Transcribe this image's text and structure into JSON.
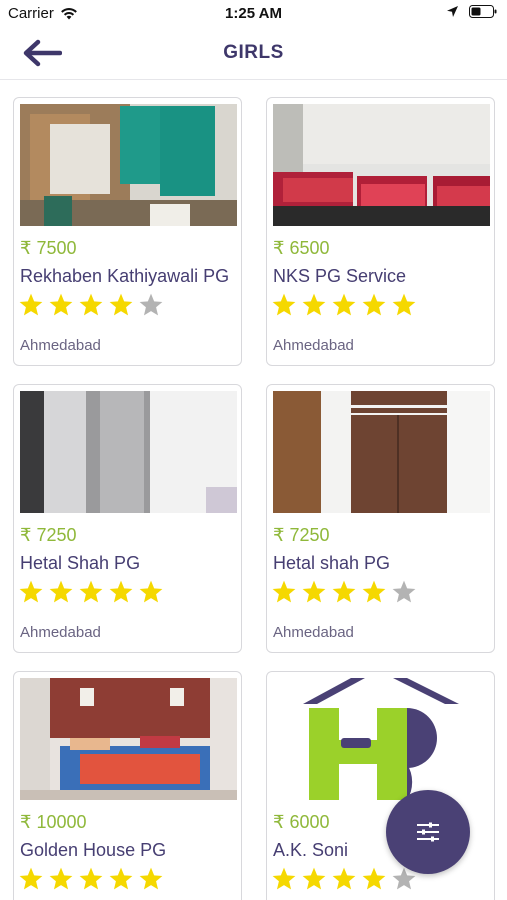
{
  "status_bar": {
    "carrier": "Carrier",
    "time": "1:25 AM"
  },
  "header": {
    "title": "GIRLS"
  },
  "colors": {
    "accent": "#4a4175",
    "price": "#8fb83a",
    "star_on": "#f5d800",
    "star_off": "#b3b3b3"
  },
  "listings": [
    {
      "price": "₹ 7500",
      "name": "Rekhaben Kathiyawali PG",
      "rating": 4,
      "city": "Ahmedabad"
    },
    {
      "price": "₹ 6500",
      "name": "NKS PG Service",
      "rating": 5,
      "city": "Ahmedabad"
    },
    {
      "price": "₹ 7250",
      "name": "Hetal Shah PG",
      "rating": 5,
      "city": "Ahmedabad"
    },
    {
      "price": "₹ 7250",
      "name": "Hetal shah PG",
      "rating": 4,
      "city": "Ahmedabad"
    },
    {
      "price": "₹ 10000",
      "name": "Golden House PG",
      "rating": 5,
      "city": ""
    },
    {
      "price": "₹ 6000",
      "name": "A.K. Soni",
      "rating": 4,
      "city": ""
    }
  ],
  "fab": {
    "icon": "filter-sliders-icon"
  }
}
